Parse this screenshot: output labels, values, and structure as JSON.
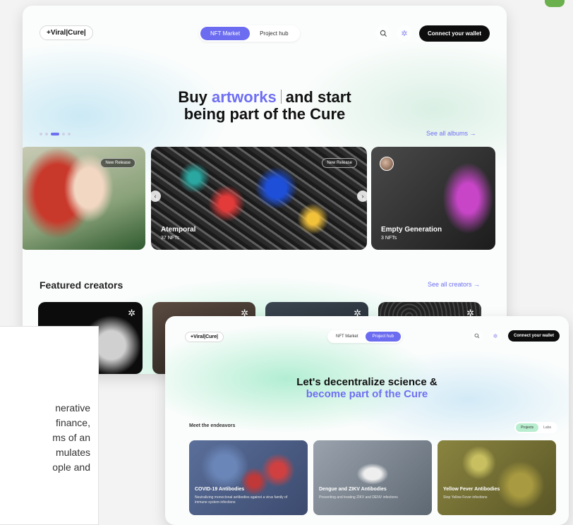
{
  "main": {
    "logo": "+Viral|Cure|",
    "tabs": [
      "NFT Market",
      "Project hub"
    ],
    "wallet": "Connect your wallet",
    "hero": {
      "line1_pre": "Buy ",
      "line1_accent": "artworks",
      "line1_post": "and start",
      "line2": "being part of the Cure"
    },
    "see_albums": "See all albums →",
    "cards": [
      {
        "badge": "New Release",
        "title": "",
        "sub": ""
      },
      {
        "badge": "New Release",
        "title": "Atemporal",
        "sub": "37 NFTs"
      },
      {
        "badge": "",
        "title": "Empty Generation",
        "sub": "3 NFTs"
      }
    ],
    "featured_title": "Featured creators",
    "see_creators": "See all creators →",
    "icons": {
      "search": "search-icon",
      "gear": "gear-icon",
      "star": "star-icon",
      "prev": "arrow-left-icon",
      "next": "arrow-right-icon"
    }
  },
  "panel": {
    "lines": [
      "nerative",
      "finance,",
      "ms of an",
      "mulates",
      "ople and"
    ]
  },
  "second": {
    "logo": "+Viral|Cure|",
    "tabs": [
      "NFT Market",
      "Project hub"
    ],
    "wallet": "Connect your wallet",
    "hero_line1": "Let's decentralize science &",
    "hero_line2": "become part of the Cure",
    "section": "Meet the endeavors",
    "toggle": [
      "Projects",
      "Labs"
    ],
    "cards": [
      {
        "title": "COVID-19 Antibodies",
        "sub": "Neutralizing monoclonal antibodies against a virus family of immune system infections"
      },
      {
        "title": "Dengue and ZIKV Antibodies",
        "sub": "Preventing and treating ZIKV and DENV infections"
      },
      {
        "title": "Yellow Fever Antibodies",
        "sub": "Stop Yellow Fever infections"
      }
    ]
  },
  "colors": {
    "accent": "#6f6ff2",
    "wallet": "#0d0d0d",
    "mint": "#aaecce"
  }
}
